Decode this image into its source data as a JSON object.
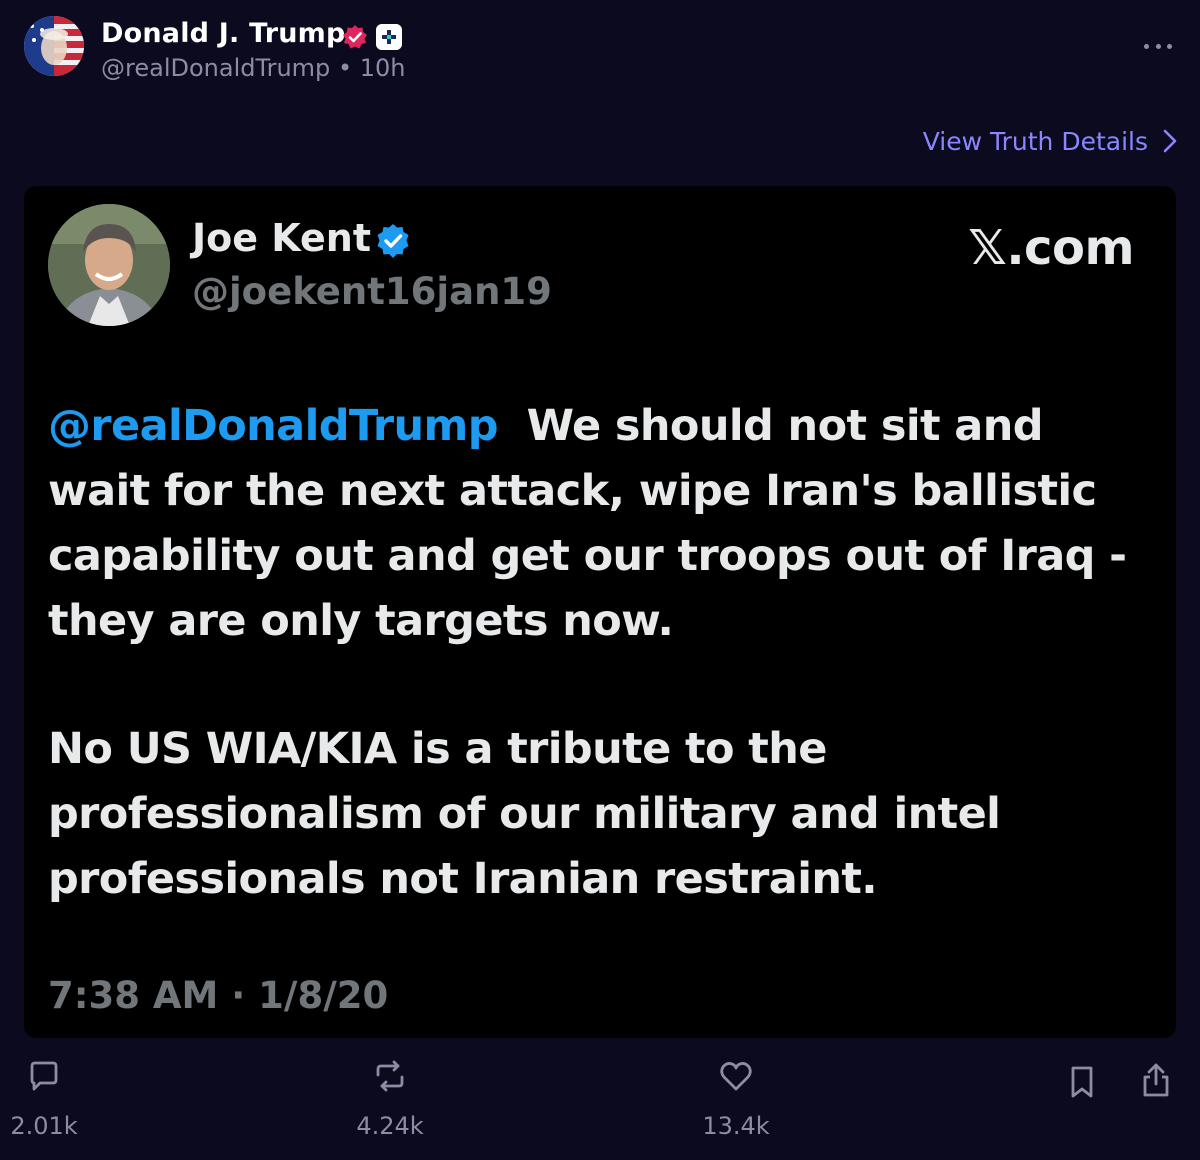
{
  "post": {
    "author_name": "Donald J. Trump",
    "author_handle": "@realDonaldTrump",
    "separator": "•",
    "age": "10h",
    "view_details_label": "View Truth Details"
  },
  "embed": {
    "name": "Joe Kent",
    "handle": "@joekent16jan19",
    "source": "𝕏.com",
    "mention": "@realDonaldTrump",
    "paragraph1_rest": "We should not sit and wait for the next attack, wipe Iran's ballistic capability out and get our troops out of Iraq - they are only targets now.",
    "paragraph2": "No US WIA/KIA is a tribute to the professionalism of our military and intel professionals not Iranian restraint.",
    "timestamp": "7:38 AM · 1/8/20"
  },
  "actions": {
    "replies": "2.01k",
    "reposts": "4.24k",
    "likes": "13.4k"
  },
  "colors": {
    "background": "#0b0a1f",
    "accent": "#8b85ff",
    "verified_red": "#e0245e",
    "x_blue": "#1d9bf0",
    "muted": "#8c8ca5"
  },
  "icons": [
    "verified-icon",
    "plus-icon",
    "more-icon",
    "chevron-right-icon",
    "reply-icon",
    "repost-icon",
    "like-icon",
    "bookmark-icon",
    "share-icon"
  ]
}
